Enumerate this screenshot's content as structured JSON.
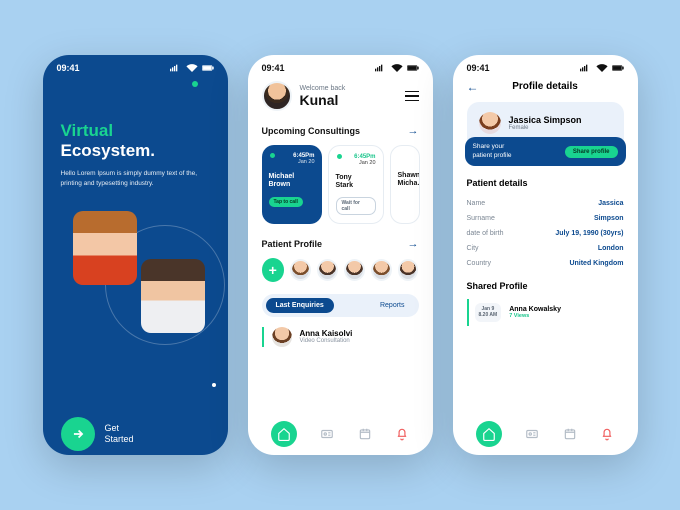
{
  "status": {
    "time": "09:41"
  },
  "splash": {
    "title1": "Virtual",
    "title2": "Ecosystem.",
    "subtitle": "Hello Lorem Ipsum is simply dummy text of the, printing and typesetting industry.",
    "cta_line1": "Get",
    "cta_line2": "Started"
  },
  "dashboard": {
    "welcome": "Welcome back",
    "username": "Kunal",
    "upcoming_label": "Upcoming Consultings",
    "cards": [
      {
        "time": "6:45Pm",
        "date": "Jan 20",
        "name1": "Michael",
        "name2": "Brown",
        "btn": "Tap to call"
      },
      {
        "time": "6:45Pm",
        "date": "Jan 20",
        "name1": "Tony",
        "name2": "Stark",
        "btn": "Wait for call"
      },
      {
        "time": "",
        "date": "",
        "name1": "Shawn",
        "name2": "Micha…",
        "btn": ""
      }
    ],
    "profile_label": "Patient Profile",
    "tabs": {
      "active": "Last Enquiries",
      "other": "Reports"
    },
    "enquiry": {
      "name": "Anna Kaisolvi",
      "sub": "Video Consultation"
    }
  },
  "profile": {
    "title": "Profile details",
    "card_name": "Jassica Simpson",
    "card_sub": "Female",
    "share_line1": "Share your",
    "share_line2": "patient profile",
    "share_btn": "Share profile",
    "dsec": "Patient details",
    "rows": [
      {
        "k": "Name",
        "v": "Jassica"
      },
      {
        "k": "Surname",
        "v": "Simpson"
      },
      {
        "k": "date of birth",
        "v": "July 19, 1990 (30yrs)"
      },
      {
        "k": "City",
        "v": "London"
      },
      {
        "k": "Country",
        "v": "United Kingdom"
      }
    ],
    "shared_label": "Shared Profile",
    "shared": {
      "date_l1": "Jan 9",
      "date_l2": "8.20 AM",
      "name": "Anna Kowalsky",
      "sub": "7 Views"
    }
  }
}
